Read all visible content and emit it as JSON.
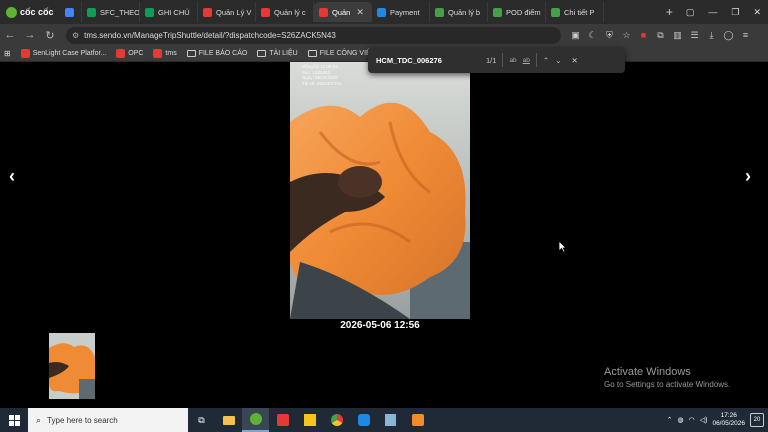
{
  "browser": {
    "brand": "cốc cốc",
    "tabs": [
      {
        "label": "",
        "color": "#4285f4"
      },
      {
        "label": "SFC_THEO",
        "color": "#0f9d58"
      },
      {
        "label": "GHI CHÚ",
        "color": "#0f9d58"
      },
      {
        "label": "Quản Lý V",
        "color": "#e53935"
      },
      {
        "label": "Quản lý c",
        "color": "#e53935"
      },
      {
        "label": "Quản",
        "color": "#e53935",
        "active": true
      },
      {
        "label": "Payment",
        "color": "#1e88e5"
      },
      {
        "label": "Quản lý b",
        "color": "#43a047"
      },
      {
        "label": "POD điểm",
        "color": "#43a047"
      },
      {
        "label": "Chi tiết P",
        "color": "#43a047"
      }
    ],
    "url": "tms.sendo.vn/ManageTripShuttle/detail/?dispatchcode=S26ZACK5N43",
    "bookmarks": [
      "SenLight Case Platfor...",
      "OPC",
      "tms",
      "FILE BÁO CÁO",
      "TÀI LIỆU",
      "FILE CÔNG VIỆC"
    ]
  },
  "findbar": {
    "query": "HCM_TDC_006276",
    "count": "1/1",
    "opt_case": "ab",
    "opt_word": "ab"
  },
  "viewer": {
    "prev": "‹",
    "next": "›",
    "timestamp": "2026-05-06 12:56",
    "photo_overlay": [
      "Đồng bộ 10:06:03",
      "Sen: 1225653",
      "Ngày: 06/05/2026",
      "Tài xế: 0363407711"
    ]
  },
  "watermark": {
    "title": "Activate Windows",
    "subtitle": "Go to Settings to activate Windows."
  },
  "taskbar": {
    "search_placeholder": "Type here to search",
    "time": "17:26",
    "date": "06/05/2026",
    "notifications": "20"
  },
  "colors": {
    "accent": "#f28c28",
    "browser_bg": "#2b2b2b"
  }
}
